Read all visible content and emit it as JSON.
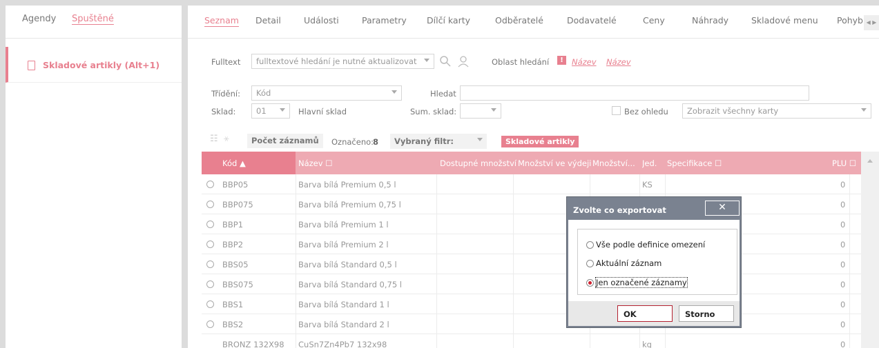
{
  "left": {
    "tabs": [
      {
        "label": "Agendy"
      },
      {
        "label": "Spuštěné"
      }
    ],
    "item": {
      "label": "Skladové artikly (Alt+1)"
    }
  },
  "tabs": [
    {
      "label": "Seznam"
    },
    {
      "label": "Detail"
    },
    {
      "label": "Události"
    },
    {
      "label": "Parametry"
    },
    {
      "label": "Dílčí karty"
    },
    {
      "label": "Odběratelé"
    },
    {
      "label": "Dodavatelé"
    },
    {
      "label": "Ceny"
    },
    {
      "label": "Náhrady"
    },
    {
      "label": "Skladové menu"
    },
    {
      "label": "Pohyb"
    }
  ],
  "filter": {
    "fulltext_label": "Fulltext",
    "fulltext_value": "fulltextové hledání je nutné aktualizovat",
    "area_label": "Oblast hledání",
    "area_badge": "!",
    "area_link1": "Název",
    "area_link2": "Název",
    "sort_label": "Třídění:",
    "sort_value": "Kód",
    "search_label": "Hledat",
    "search_value": "",
    "store_label": "Sklad:",
    "store_value": "01",
    "store_name": "Hlavní sklad",
    "sum_label": "Sum. sklad:",
    "regardless_label": "Bez ohledu",
    "show_all": "Zobrazit všechny karty"
  },
  "toolbar": {
    "count_button": "Počet záznamů",
    "marked_label": "Označeno:",
    "marked_value": "8",
    "filter_label": "Vybraný filtr:",
    "filter_badge": "Skladové artikly"
  },
  "grid": {
    "columns": [
      "Kód ▲",
      "Název ☐",
      "Dostupné množství",
      "Množství ve výdeji",
      "Množství...",
      "Jed.",
      "Specifikace ☐",
      "PLU ☐"
    ],
    "rows": [
      {
        "kod": "BBP05",
        "nazev": "Barva bílá Premium 0,5 l",
        "jed": "KS",
        "plu": "0"
      },
      {
        "kod": "BBP075",
        "nazev": "Barva bílá Premium 0,75 l",
        "jed": "",
        "plu": "0"
      },
      {
        "kod": "BBP1",
        "nazev": "Barva bílá Premium 1 l",
        "jed": "",
        "plu": "0"
      },
      {
        "kod": "BBP2",
        "nazev": "Barva bílá Premium 2 l",
        "jed": "",
        "plu": "0"
      },
      {
        "kod": "BBS05",
        "nazev": "Barva bílá Standard 0,5 l",
        "jed": "",
        "plu": "0"
      },
      {
        "kod": "BBS075",
        "nazev": "Barva bílá Standard 0,75 l",
        "jed": "",
        "plu": "0"
      },
      {
        "kod": "BBS1",
        "nazev": "Barva bílá Standard 1 l",
        "jed": "",
        "plu": "0"
      },
      {
        "kod": "BBS2",
        "nazev": "Barva bílá Standard 2 l",
        "jed": "",
        "plu": "0"
      },
      {
        "kod": "BRONZ 132X98",
        "nazev": "CuSn7Zn4Pb7 132x98",
        "jed": "kg",
        "plu": "0"
      }
    ]
  },
  "dialog": {
    "title": "Zvolte co exportovat",
    "close": "✕",
    "options": [
      "Vše podle definice omezení",
      "Aktuální záznam",
      "Jen označené záznamy"
    ],
    "ok": "OK",
    "cancel": "Storno"
  }
}
